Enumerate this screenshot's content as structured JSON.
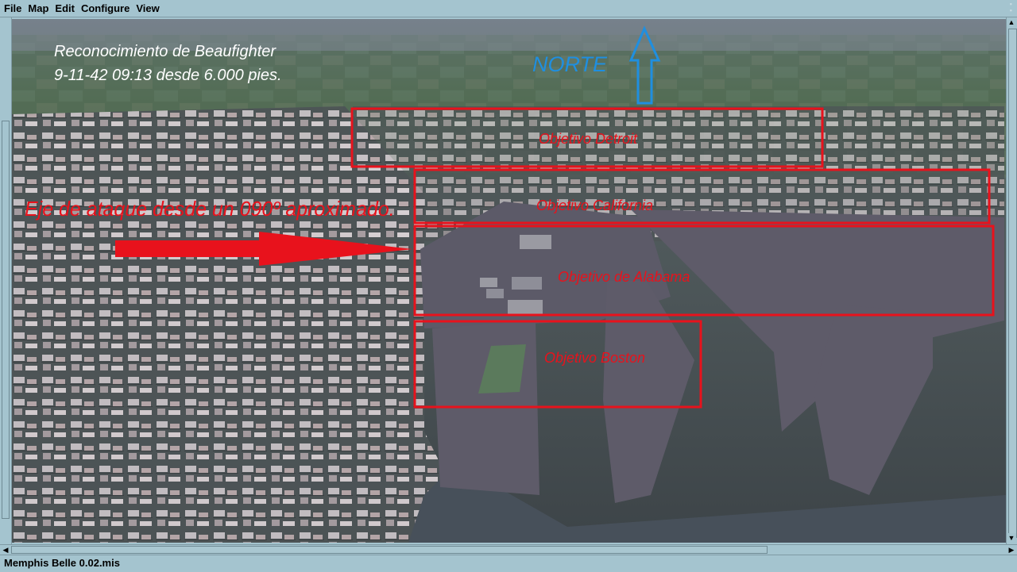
{
  "menu": [
    "File",
    "Map",
    "Edit",
    "Configure",
    "View"
  ],
  "map": {
    "caption_line1": "Reconocimiento de Beaufighter",
    "caption_line2": "9-11-42 09:13 desde 6.000 pies.",
    "north_label": "NORTE",
    "attack_axis_label": "Eje de ataque desde un 090º aproximado.",
    "targets": [
      {
        "label": "Objetivo Detroit"
      },
      {
        "label": "Objetivo California"
      },
      {
        "label": "Objetivo de Alabama"
      },
      {
        "label": "Objetivo Boston"
      }
    ],
    "colors": {
      "target_box": "#e8121c",
      "north_arrow": "#1f8fe0",
      "attack_arrow": "#e8121c",
      "caption": "#ffffff"
    }
  },
  "status": {
    "filename": "Memphis Belle 0.02.mis"
  }
}
